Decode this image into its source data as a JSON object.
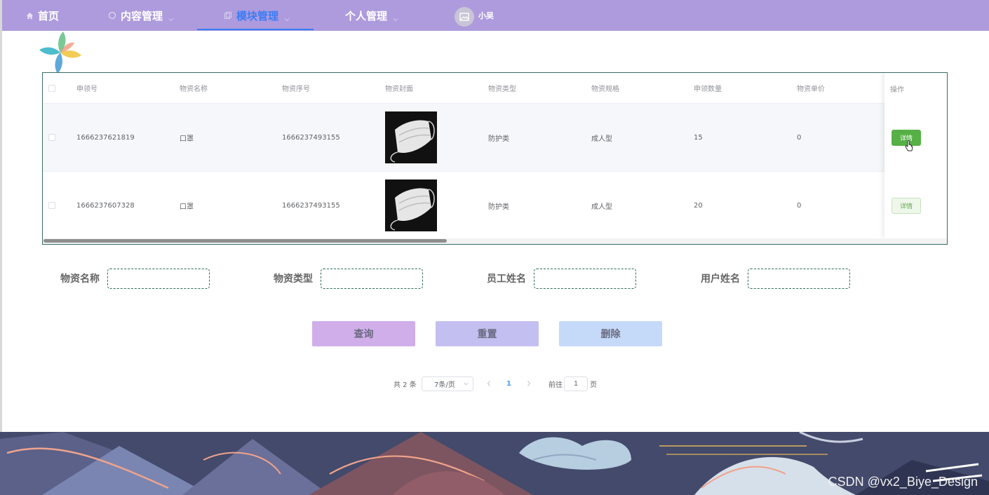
{
  "nav": {
    "home": "首页",
    "content": "内容管理",
    "module": "模块管理",
    "personal": "个人管理",
    "username": "小吴",
    "active_color": "#3b7cf5",
    "bar_color": "#ad9bdd"
  },
  "table": {
    "headers": {
      "apply_no": "申领号",
      "name": "物资名称",
      "serial": "物资序号",
      "cover": "物资封面",
      "type": "物资类型",
      "spec": "物资规格",
      "qty": "申领数量",
      "price": "物资单价",
      "op": "操作"
    },
    "rows": [
      {
        "apply_no": "1666237621819",
        "name": "口罩",
        "serial": "1666237493155",
        "type": "防护类",
        "spec": "成人型",
        "qty": "15",
        "price": "0",
        "op": "详情"
      },
      {
        "apply_no": "1666237607328",
        "name": "口罩",
        "serial": "1666237493155",
        "type": "防护类",
        "spec": "成人型",
        "qty": "20",
        "price": "0",
        "op": "详情"
      }
    ]
  },
  "filters": {
    "name_label": "物资名称",
    "type_label": "物资类型",
    "staff_label": "员工姓名",
    "user_label": "用户姓名"
  },
  "actions": {
    "query": "查询",
    "reset": "重置",
    "delete": "删除"
  },
  "pagination": {
    "total": "共 2 条",
    "page_size": "7条/页",
    "current": "1",
    "goto_prefix": "前往",
    "goto_value": "1",
    "goto_suffix": "页"
  },
  "watermark": "CSDN @vx2_Biye_Design"
}
